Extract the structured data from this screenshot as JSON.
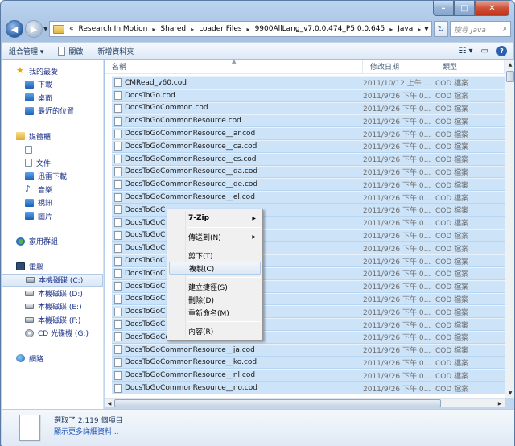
{
  "window": {
    "caption": {
      "minimize": "–",
      "maximize": "□",
      "close": "✕"
    }
  },
  "address": {
    "crumbs": [
      "«",
      "Research In Motion",
      "Shared",
      "Loader Files",
      "9900AllLang_v7.0.0.474_P5.0.0.645",
      "Java"
    ],
    "search_placeholder": "搜尋 Java"
  },
  "toolbar": {
    "organize_label": "組合管理 ▾",
    "open_label": "開啟",
    "new_folder_label": "新增資料夾"
  },
  "nav": {
    "favorites": "我的最愛",
    "downloads": "下載",
    "desktop": "桌面",
    "recent": "最近的位置",
    "libraries": "媒體櫃",
    "lib_items": [
      "",
      "文件",
      "迅雷下載",
      "音樂",
      "視訊",
      "圖片"
    ],
    "homegroup": "家用群組",
    "computer": "電腦",
    "drives": [
      "本機磁碟 (C:)",
      "本機磁碟 (D:)",
      "本機磁碟 (E:)",
      "本機磁碟 (F:)",
      "CD 光碟機 (G:)"
    ],
    "network": "網路"
  },
  "columns": {
    "name": "名稱",
    "date": "修改日期",
    "type": "類型"
  },
  "files": [
    {
      "name": "CMRead_v60.cod",
      "date": "2011/10/12 上午 ...",
      "type": "COD 檔案"
    },
    {
      "name": "DocsToGo.cod",
      "date": "2011/9/26 下午 0...",
      "type": "COD 檔案"
    },
    {
      "name": "DocsToGoCommon.cod",
      "date": "2011/9/26 下午 0...",
      "type": "COD 檔案"
    },
    {
      "name": "DocsToGoCommonResource.cod",
      "date": "2011/9/26 下午 0...",
      "type": "COD 檔案"
    },
    {
      "name": "DocsToGoCommonResource__ar.cod",
      "date": "2011/9/26 下午 0...",
      "type": "COD 檔案"
    },
    {
      "name": "DocsToGoCommonResource__ca.cod",
      "date": "2011/9/26 下午 0...",
      "type": "COD 檔案"
    },
    {
      "name": "DocsToGoCommonResource__cs.cod",
      "date": "2011/9/26 下午 0...",
      "type": "COD 檔案"
    },
    {
      "name": "DocsToGoCommonResource__da.cod",
      "date": "2011/9/26 下午 0...",
      "type": "COD 檔案"
    },
    {
      "name": "DocsToGoCommonResource__de.cod",
      "date": "2011/9/26 下午 0...",
      "type": "COD 檔案"
    },
    {
      "name": "DocsToGoCommonResource__el.cod",
      "date": "2011/9/26 下午 0...",
      "type": "COD 檔案"
    },
    {
      "name": "DocsToGoC",
      "date": "2011/9/26 下午 0...",
      "type": "COD 檔案"
    },
    {
      "name": "DocsToGoC                            d",
      "date": "2011/9/26 下午 0...",
      "type": "COD 檔案"
    },
    {
      "name": "DocsToGoC",
      "date": "2011/9/26 下午 0...",
      "type": "COD 檔案"
    },
    {
      "name": "DocsToGoC",
      "date": "2011/9/26 下午 0...",
      "type": "COD 檔案"
    },
    {
      "name": "DocsToGoC",
      "date": "2011/9/26 下午 0...",
      "type": "COD 檔案"
    },
    {
      "name": "DocsToGoC",
      "date": "2011/9/26 下午 0...",
      "type": "COD 檔案"
    },
    {
      "name": "DocsToGoC",
      "date": "2011/9/26 下午 0...",
      "type": "COD 檔案"
    },
    {
      "name": "DocsToGoC",
      "date": "2011/9/26 下午 0...",
      "type": "COD 檔案"
    },
    {
      "name": "DocsToGoC",
      "date": "2011/9/26 下午 0...",
      "type": "COD 檔案"
    },
    {
      "name": "DocsToGoC",
      "date": "2011/9/26 下午 0...",
      "type": "COD 檔案"
    },
    {
      "name": "DocsToGoCommonResource__it.cod",
      "date": "2011/9/26 下午 0...",
      "type": "COD 檔案"
    },
    {
      "name": "DocsToGoCommonResource__ja.cod",
      "date": "2011/9/26 下午 0...",
      "type": "COD 檔案"
    },
    {
      "name": "DocsToGoCommonResource__ko.cod",
      "date": "2011/9/26 下午 0...",
      "type": "COD 檔案"
    },
    {
      "name": "DocsToGoCommonResource__nl.cod",
      "date": "2011/9/26 下午 0...",
      "type": "COD 檔案"
    },
    {
      "name": "DocsToGoCommonResource__no.cod",
      "date": "2011/9/26 下午 0...",
      "type": "COD 檔案"
    }
  ],
  "context_menu": {
    "items": [
      "7-Zip",
      "傳送到(N)",
      "剪下(T)",
      "複製(C)",
      "建立捷徑(S)",
      "刪除(D)",
      "重新命名(M)",
      "內容(R)"
    ],
    "highlighted_index": 3
  },
  "details": {
    "selected": "選取了 2,119 個項目",
    "more": "顯示更多詳細資料..."
  },
  "colors": {
    "selection": "#cde3f8",
    "accent": "#1e3287"
  }
}
